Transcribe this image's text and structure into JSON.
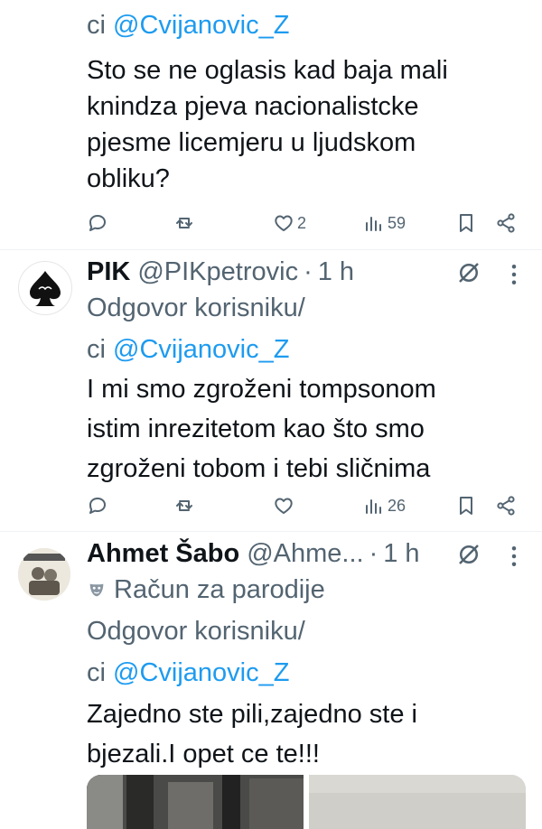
{
  "tweet1": {
    "reply_prefix": "ci ",
    "mention": "@Cvijanovic_Z",
    "body": [
      "Sto se ne oglasis kad baja mali",
      "knindza pjeva nacionalistcke",
      "pjesme licemjeru u ljudskom",
      "obliku?"
    ],
    "likes": "2",
    "views": "59"
  },
  "tweet2": {
    "name": "PIK",
    "handle": "@PIKpetrovic",
    "sep": "·",
    "time": "1 h",
    "reply_to_label": "Odgovor korisniku/",
    "reply_prefix": "ci ",
    "mention": "@Cvijanovic_Z",
    "body": [
      "I mi smo zgroženi tompsonom",
      "istim inrezitetom kao što smo",
      "zgroženi tobom i tebi sličnima"
    ],
    "views": "26"
  },
  "tweet3": {
    "name": "Ahmet Šabo",
    "handle": "@Ahme...",
    "sep": "·",
    "time": "1 h",
    "parody_label": "Račun za parodije",
    "reply_to_label": "Odgovor korisniku/",
    "reply_prefix": "ci ",
    "mention": "@Cvijanovic_Z",
    "body": [
      "Zajedno ste pili,zajedno ste i",
      "bjezali.I opet ce te!!!"
    ]
  },
  "colors": {
    "accent": "#1d9bf0",
    "secondary_text": "#536471",
    "primary_text": "#0f1419",
    "divider": "#eff3f4"
  },
  "icons": {
    "reply": "reply-icon",
    "retweet": "retweet-icon",
    "like": "heart-icon",
    "views": "views-icon",
    "bookmark": "bookmark-icon",
    "share": "share-icon",
    "grok": "grok-icon",
    "more": "more-icon",
    "parody": "parody-mask-icon"
  }
}
